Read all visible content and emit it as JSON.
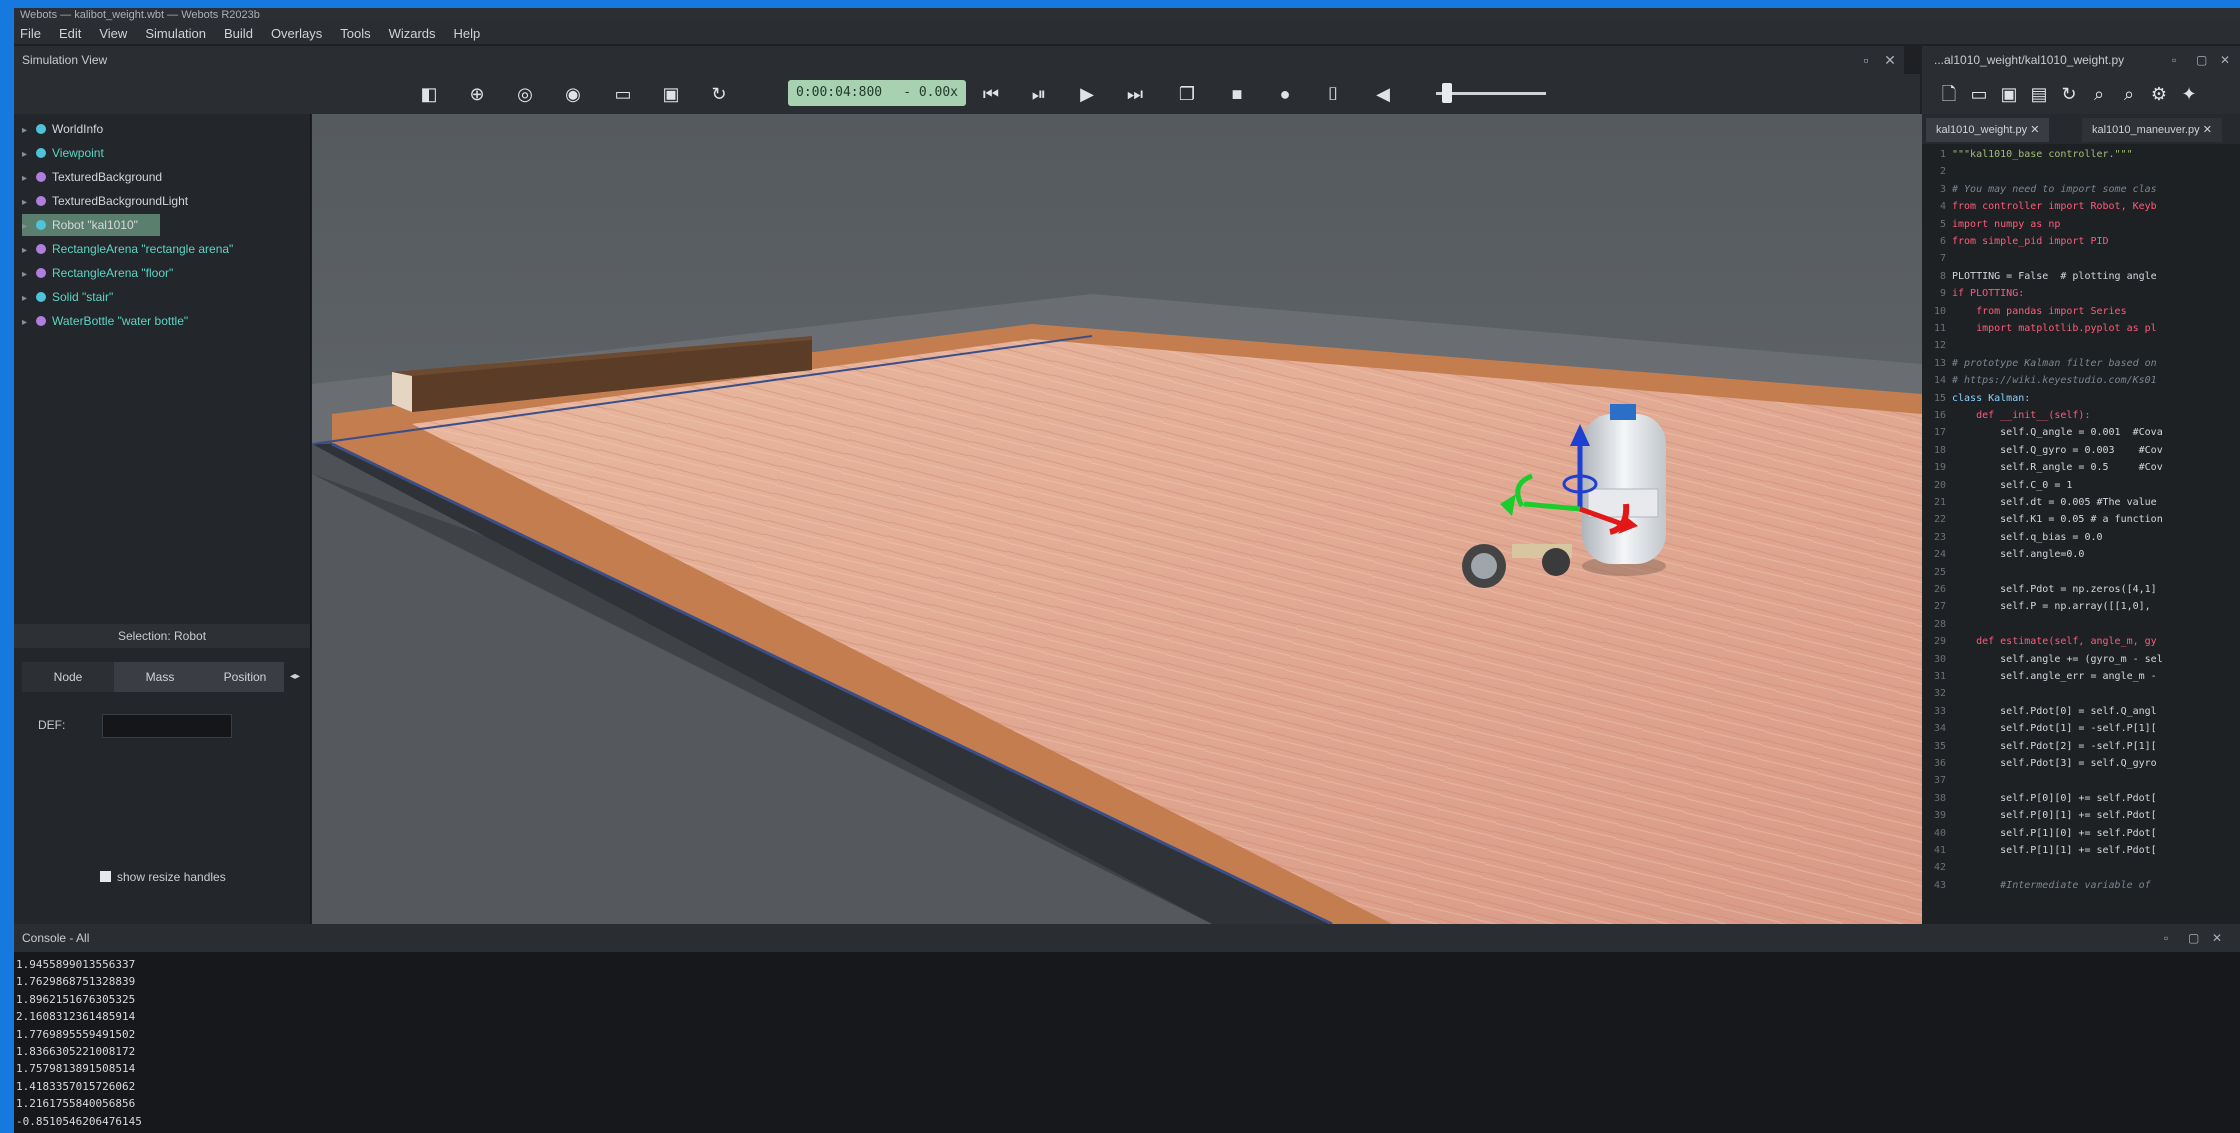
{
  "window": {
    "title": "Webots — kalibot_weight.wbt — Webots R2023b"
  },
  "menu": [
    "File",
    "Edit",
    "View",
    "Simulation",
    "Build",
    "Overlays",
    "Tools",
    "Wizards",
    "Help"
  ],
  "simulation_view": {
    "title": "Simulation View"
  },
  "toolbar": {
    "time": "0:00:04:800",
    "speed": "- 0.00x"
  },
  "scene_tree": [
    {
      "label": "WorldInfo",
      "color": "#4fc3d9"
    },
    {
      "label": "Viewpoint",
      "color": "#4fc3d9"
    },
    {
      "label": "TexturedBackground",
      "color": "#b07de0"
    },
    {
      "label": "TexturedBackgroundLight",
      "color": "#b07de0"
    },
    {
      "label": "Robot \"kal1010\"",
      "color": "#4fc3d9",
      "selected": true
    },
    {
      "label": "RectangleArena \"rectangle arena\"",
      "color": "#b07de0"
    },
    {
      "label": "RectangleArena \"floor\"",
      "color": "#b07de0"
    },
    {
      "label": "Solid \"stair\"",
      "color": "#4fc3d9"
    },
    {
      "label": "WaterBottle \"water bottle\"",
      "color": "#b07de0"
    }
  ],
  "properties": {
    "selection_title": "Selection: Robot",
    "tabs": [
      "Node",
      "Mass",
      "Position"
    ],
    "def_label": "DEF:",
    "show_resize_handles": "show resize handles"
  },
  "editor": {
    "title": "...al1010_weight/kal1010_weight.py",
    "tabs": [
      "kal1010_weight.py",
      "kal1010_maneuver.py"
    ],
    "lines": [
      {
        "n": "1",
        "t": "\"\"\"kal1010_base controller.\"\"\"",
        "c": "str"
      },
      {
        "n": "2",
        "t": "",
        "c": ""
      },
      {
        "n": "3",
        "t": "# You may need to import some clas",
        "c": "cm"
      },
      {
        "n": "4",
        "t": "from controller import Robot, Keyb",
        "c": "kw"
      },
      {
        "n": "5",
        "t": "import numpy as np",
        "c": "kw"
      },
      {
        "n": "6",
        "t": "from simple_pid import PID",
        "c": "kw"
      },
      {
        "n": "7",
        "t": "",
        "c": ""
      },
      {
        "n": "8",
        "t": "PLOTTING = False  # plotting angle",
        "c": ""
      },
      {
        "n": "9",
        "t": "if PLOTTING:",
        "c": "kw"
      },
      {
        "n": "10",
        "t": "    from pandas import Series",
        "c": "kw"
      },
      {
        "n": "11",
        "t": "    import matplotlib.pyplot as pl",
        "c": "kw"
      },
      {
        "n": "12",
        "t": "",
        "c": ""
      },
      {
        "n": "13",
        "t": "# prototype Kalman filter based on",
        "c": "cm"
      },
      {
        "n": "14",
        "t": "# https://wiki.keyestudio.com/Ks01",
        "c": "cm"
      },
      {
        "n": "15",
        "t": "class Kalman:",
        "c": "cls"
      },
      {
        "n": "16",
        "t": "    def __init__(self):",
        "c": "kw"
      },
      {
        "n": "17",
        "t": "        self.Q_angle = 0.001  #Cova",
        "c": ""
      },
      {
        "n": "18",
        "t": "        self.Q_gyro = 0.003    #Cov",
        "c": ""
      },
      {
        "n": "19",
        "t": "        self.R_angle = 0.5     #Cov",
        "c": ""
      },
      {
        "n": "20",
        "t": "        self.C_0 = 1",
        "c": ""
      },
      {
        "n": "21",
        "t": "        self.dt = 0.005 #The value",
        "c": ""
      },
      {
        "n": "22",
        "t": "        self.K1 = 0.05 # a function",
        "c": ""
      },
      {
        "n": "23",
        "t": "        self.q_bias = 0.0",
        "c": ""
      },
      {
        "n": "24",
        "t": "        self.angle=0.0",
        "c": ""
      },
      {
        "n": "25",
        "t": "",
        "c": ""
      },
      {
        "n": "26",
        "t": "        self.Pdot = np.zeros([4,1]",
        "c": ""
      },
      {
        "n": "27",
        "t": "        self.P = np.array([[1,0],",
        "c": ""
      },
      {
        "n": "28",
        "t": "",
        "c": ""
      },
      {
        "n": "29",
        "t": "    def estimate(self, angle_m, gy",
        "c": "kw"
      },
      {
        "n": "30",
        "t": "        self.angle += (gyro_m - sel",
        "c": ""
      },
      {
        "n": "31",
        "t": "        self.angle_err = angle_m -",
        "c": ""
      },
      {
        "n": "32",
        "t": "",
        "c": ""
      },
      {
        "n": "33",
        "t": "        self.Pdot[0] = self.Q_angl",
        "c": ""
      },
      {
        "n": "34",
        "t": "        self.Pdot[1] = -self.P[1][",
        "c": ""
      },
      {
        "n": "35",
        "t": "        self.Pdot[2] = -self.P[1][",
        "c": ""
      },
      {
        "n": "36",
        "t": "        self.Pdot[3] = self.Q_gyro",
        "c": ""
      },
      {
        "n": "37",
        "t": "",
        "c": ""
      },
      {
        "n": "38",
        "t": "        self.P[0][0] += self.Pdot[",
        "c": ""
      },
      {
        "n": "39",
        "t": "        self.P[0][1] += self.Pdot[",
        "c": ""
      },
      {
        "n": "40",
        "t": "        self.P[1][0] += self.Pdot[",
        "c": ""
      },
      {
        "n": "41",
        "t": "        self.P[1][1] += self.Pdot[",
        "c": ""
      },
      {
        "n": "42",
        "t": "",
        "c": ""
      },
      {
        "n": "43",
        "t": "        #Intermediate variable of",
        "c": "cm"
      }
    ]
  },
  "console": {
    "title": "Console - All",
    "lines": [
      "1.9455899013556337",
      "1.7629868751328839",
      "1.8962151676305325",
      "2.1608312361485914",
      "1.7769895559491502",
      "1.8366305221008172",
      "1.7579813891508514",
      "1.4183357015726062",
      "1.2161755840056856",
      "-0.8510546206476145"
    ]
  }
}
